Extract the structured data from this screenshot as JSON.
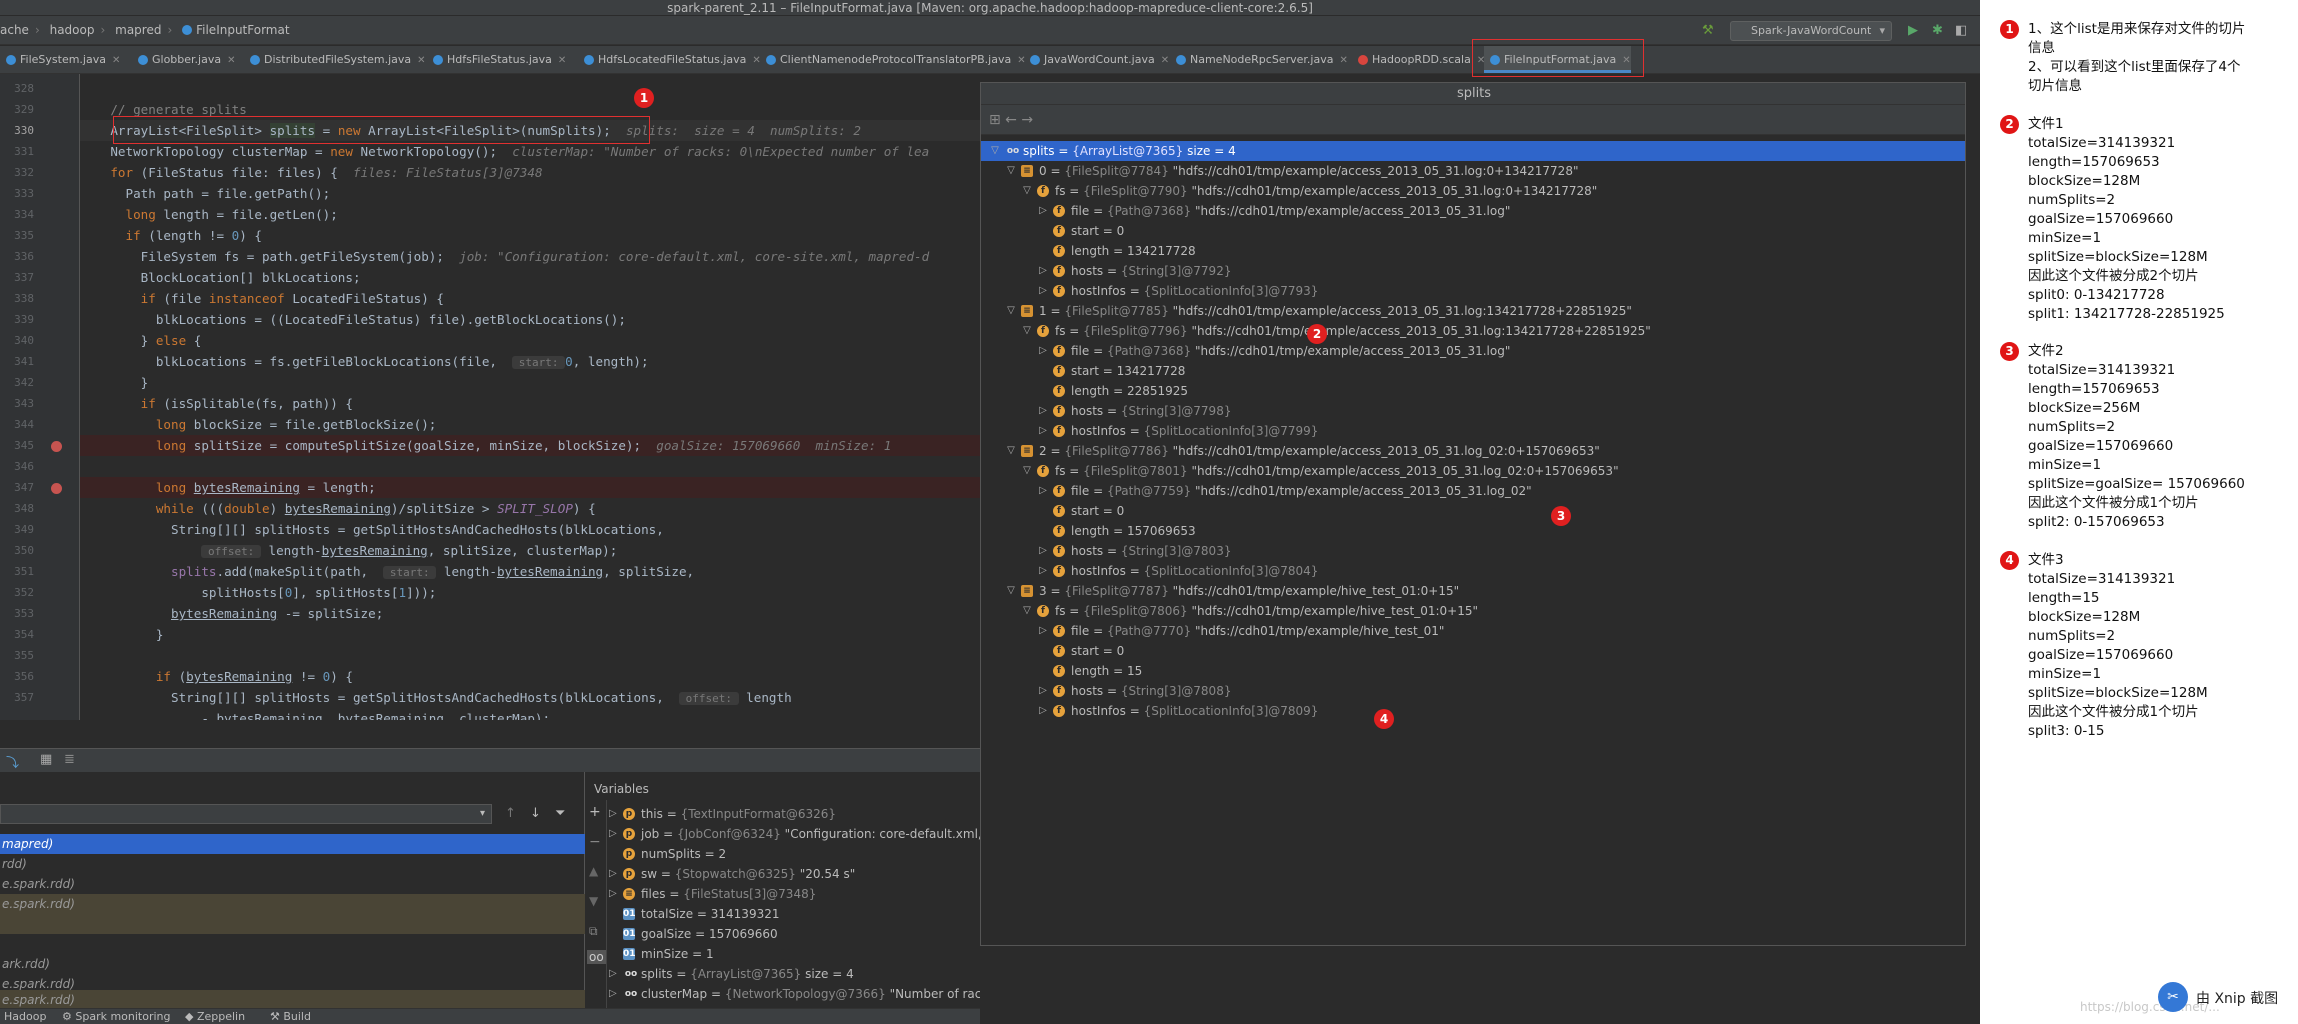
{
  "window": {
    "title": "spark-parent_2.11 – FileInputFormat.java [Maven: org.apache.hadoop:hadoop-mapreduce-client-core:2.6.5]"
  },
  "breadcrumb": [
    "ache",
    "hadoop",
    "mapred",
    "FileInputFormat"
  ],
  "run_config": "Spark-JavaWordCount",
  "tabs": [
    {
      "label": "FileSystem.java",
      "type": "java"
    },
    {
      "label": "Globber.java",
      "type": "java"
    },
    {
      "label": "DistributedFileSystem.java",
      "type": "java"
    },
    {
      "label": "HdfsFileStatus.java",
      "type": "java"
    },
    {
      "label": "HdfsLocatedFileStatus.java",
      "type": "java"
    },
    {
      "label": "ClientNamenodeProtocolTranslatorPB.java",
      "type": "java"
    },
    {
      "label": "JavaWordCount.java",
      "type": "java"
    },
    {
      "label": "NameNodeRpcServer.java",
      "type": "java"
    },
    {
      "label": "HadoopRDD.scala",
      "type": "scala"
    },
    {
      "label": "FileInputFormat.java",
      "type": "java",
      "active": true
    }
  ],
  "editor": {
    "line_numbers": [
      "328",
      "329",
      "330",
      "331",
      "332",
      "333",
      "334",
      "335",
      "336",
      "337",
      "338",
      "339",
      "340",
      "341",
      "342",
      "343",
      "344",
      "345",
      "346",
      "347",
      "348",
      "349",
      "350",
      "351",
      "352",
      "353",
      "354",
      "355",
      "356",
      "357"
    ],
    "current_line": "330",
    "breakpoint_lines": [
      "345",
      "347"
    ],
    "annotation_1": "1"
  },
  "popup": {
    "title": "splits",
    "toolbar": "⊞  ←  →",
    "rows": [
      {
        "arrow": "▽",
        "icon": "oo",
        "name": "splits",
        "type": "{ArrayList@7365}",
        "value": "size = 4",
        "selected": true
      },
      {
        "arrow": "▽",
        "icon": "≡",
        "name": "0",
        "type": "{FileSplit@7784}",
        "value": "\"hdfs://cdh01/tmp/example/access_2013_05_31.log:0+134217728\""
      },
      {
        "arrow": "▽",
        "icon": "f",
        "name": "fs",
        "type": "{FileSplit@7790}",
        "value": "\"hdfs://cdh01/tmp/example/access_2013_05_31.log:0+134217728\""
      },
      {
        "arrow": "▷",
        "icon": "f",
        "name": "file",
        "type": "{Path@7368}",
        "value": "\"hdfs://cdh01/tmp/example/access_2013_05_31.log\""
      },
      {
        "arrow": "",
        "icon": "f",
        "name": "start",
        "type": "",
        "value": "0"
      },
      {
        "arrow": "",
        "icon": "f",
        "name": "length",
        "type": "",
        "value": "134217728"
      },
      {
        "arrow": "▷",
        "icon": "f",
        "name": "hosts",
        "type": "{String[3]@7792}",
        "value": ""
      },
      {
        "arrow": "▷",
        "icon": "f",
        "name": "hostInfos",
        "type": "{SplitLocationInfo[3]@7793}",
        "value": ""
      },
      {
        "arrow": "▽",
        "icon": "≡",
        "name": "1",
        "type": "{FileSplit@7785}",
        "value": "\"hdfs://cdh01/tmp/example/access_2013_05_31.log:134217728+22851925\""
      },
      {
        "arrow": "▽",
        "icon": "f",
        "name": "fs",
        "type": "{FileSplit@7796}",
        "value": "\"hdfs://cdh01/tmp/example/access_2013_05_31.log:134217728+22851925\""
      },
      {
        "arrow": "▷",
        "icon": "f",
        "name": "file",
        "type": "{Path@7368}",
        "value": "\"hdfs://cdh01/tmp/example/access_2013_05_31.log\""
      },
      {
        "arrow": "",
        "icon": "f",
        "name": "start",
        "type": "",
        "value": "134217728"
      },
      {
        "arrow": "",
        "icon": "f",
        "name": "length",
        "type": "",
        "value": "22851925"
      },
      {
        "arrow": "▷",
        "icon": "f",
        "name": "hosts",
        "type": "{String[3]@7798}",
        "value": ""
      },
      {
        "arrow": "▷",
        "icon": "f",
        "name": "hostInfos",
        "type": "{SplitLocationInfo[3]@7799}",
        "value": ""
      },
      {
        "arrow": "▽",
        "icon": "≡",
        "name": "2",
        "type": "{FileSplit@7786}",
        "value": "\"hdfs://cdh01/tmp/example/access_2013_05_31.log_02:0+157069653\""
      },
      {
        "arrow": "▽",
        "icon": "f",
        "name": "fs",
        "type": "{FileSplit@7801}",
        "value": "\"hdfs://cdh01/tmp/example/access_2013_05_31.log_02:0+157069653\""
      },
      {
        "arrow": "▷",
        "icon": "f",
        "name": "file",
        "type": "{Path@7759}",
        "value": "\"hdfs://cdh01/tmp/example/access_2013_05_31.log_02\""
      },
      {
        "arrow": "",
        "icon": "f",
        "name": "start",
        "type": "",
        "value": "0"
      },
      {
        "arrow": "",
        "icon": "f",
        "name": "length",
        "type": "",
        "value": "157069653"
      },
      {
        "arrow": "▷",
        "icon": "f",
        "name": "hosts",
        "type": "{String[3]@7803}",
        "value": ""
      },
      {
        "arrow": "▷",
        "icon": "f",
        "name": "hostInfos",
        "type": "{SplitLocationInfo[3]@7804}",
        "value": ""
      },
      {
        "arrow": "▽",
        "icon": "≡",
        "name": "3",
        "type": "{FileSplit@7787}",
        "value": "\"hdfs://cdh01/tmp/example/hive_test_01:0+15\""
      },
      {
        "arrow": "▽",
        "icon": "f",
        "name": "fs",
        "type": "{FileSplit@7806}",
        "value": "\"hdfs://cdh01/tmp/example/hive_test_01:0+15\""
      },
      {
        "arrow": "▷",
        "icon": "f",
        "name": "file",
        "type": "{Path@7770}",
        "value": "\"hdfs://cdh01/tmp/example/hive_test_01\""
      },
      {
        "arrow": "",
        "icon": "f",
        "name": "start",
        "type": "",
        "value": "0"
      },
      {
        "arrow": "",
        "icon": "f",
        "name": "length",
        "type": "",
        "value": "15"
      },
      {
        "arrow": "▷",
        "icon": "f",
        "name": "hosts",
        "type": "{String[3]@7808}",
        "value": ""
      },
      {
        "arrow": "▷",
        "icon": "f",
        "name": "hostInfos",
        "type": "{SplitLocationInfo[3]@7809}",
        "value": ""
      }
    ],
    "markers": [
      "2",
      "3",
      "4"
    ]
  },
  "frames": {
    "rows": [
      {
        "text": "mapred)",
        "selected": true
      },
      {
        "text": "rdd)"
      },
      {
        "text": "e.spark.rdd)"
      },
      {
        "text": "e.spark.rdd)",
        "lib": true
      },
      {
        "text": ""
      },
      {
        "text": ""
      },
      {
        "text": "ark.rdd)"
      },
      {
        "text": "e.spark.rdd)"
      },
      {
        "text": "e.spark.rdd)",
        "lib": true
      }
    ]
  },
  "variables": {
    "title": "Variables",
    "rows": [
      {
        "arrow": "▷",
        "icon": "p",
        "name": "this",
        "type": "{TextInputFormat@6326}",
        "value": ""
      },
      {
        "arrow": "▷",
        "icon": "p",
        "name": "job",
        "type": "{JobConf@6324}",
        "value": "\"Configuration: core-default.xml,"
      },
      {
        "arrow": "",
        "icon": "p",
        "name": "numSplits",
        "type": "",
        "value": "2"
      },
      {
        "arrow": "▷",
        "icon": "p",
        "name": "sw",
        "type": "{Stopwatch@6325}",
        "value": "\"20.54 s\""
      },
      {
        "arrow": "▷",
        "icon": "≡",
        "name": "files",
        "type": "{FileStatus[3]@7348}",
        "value": ""
      },
      {
        "arrow": "",
        "icon": "01",
        "name": "totalSize",
        "type": "",
        "value": "314139321"
      },
      {
        "arrow": "",
        "icon": "01",
        "name": "goalSize",
        "type": "",
        "value": "157069660"
      },
      {
        "arrow": "",
        "icon": "01",
        "name": "minSize",
        "type": "",
        "value": "1"
      },
      {
        "arrow": "▷",
        "icon": "oo",
        "name": "splits",
        "type": "{ArrayList@7365}",
        "value": "size = 4"
      },
      {
        "arrow": "▷",
        "icon": "oo",
        "name": "clusterMap",
        "type": "{NetworkTopology@7366}",
        "value": "\"Number of racks: 0\\nExpected number of leaves:0\\n\"",
        "link": "View"
      }
    ]
  },
  "status_bar": [
    "Hadoop",
    "Spark monitoring",
    "Zeppelin",
    "Build"
  ],
  "notes": [
    {
      "badge": "1",
      "lines": [
        "1、这个list是用来保存对文件的切片",
        "信息",
        "2、可以看到这个list里面保存了4个",
        "切片信息"
      ]
    },
    {
      "badge": "2",
      "lines": [
        "文件1",
        "totalSize=314139321",
        "length=157069653",
        "blockSize=128M",
        "numSplits=2",
        "goalSize=157069660",
        "minSize=1",
        "splitSize=blockSize=128M",
        "因此这个文件被分成2个切片",
        "split0: 0-134217728",
        "split1: 134217728-22851925"
      ]
    },
    {
      "badge": "3",
      "lines": [
        "文件2",
        "totalSize=314139321",
        "length=157069653",
        "blockSize=256M",
        "numSplits=2",
        "goalSize=157069660",
        "minSize=1",
        "splitSize=goalSize= 157069660",
        "因此这个文件被分成1个切片",
        "split2: 0-157069653"
      ]
    },
    {
      "badge": "4",
      "lines": [
        "文件3",
        "totalSize=314139321",
        "length=15",
        "blockSize=128M",
        "numSplits=2",
        "goalSize=157069660",
        "minSize=1",
        "splitSize=blockSize=128M",
        "因此这个文件被分成1个切片",
        "split3: 0-15"
      ]
    }
  ],
  "watermark": "由 Xnip 截图",
  "csdn": "https://blog.csdn.net/..."
}
